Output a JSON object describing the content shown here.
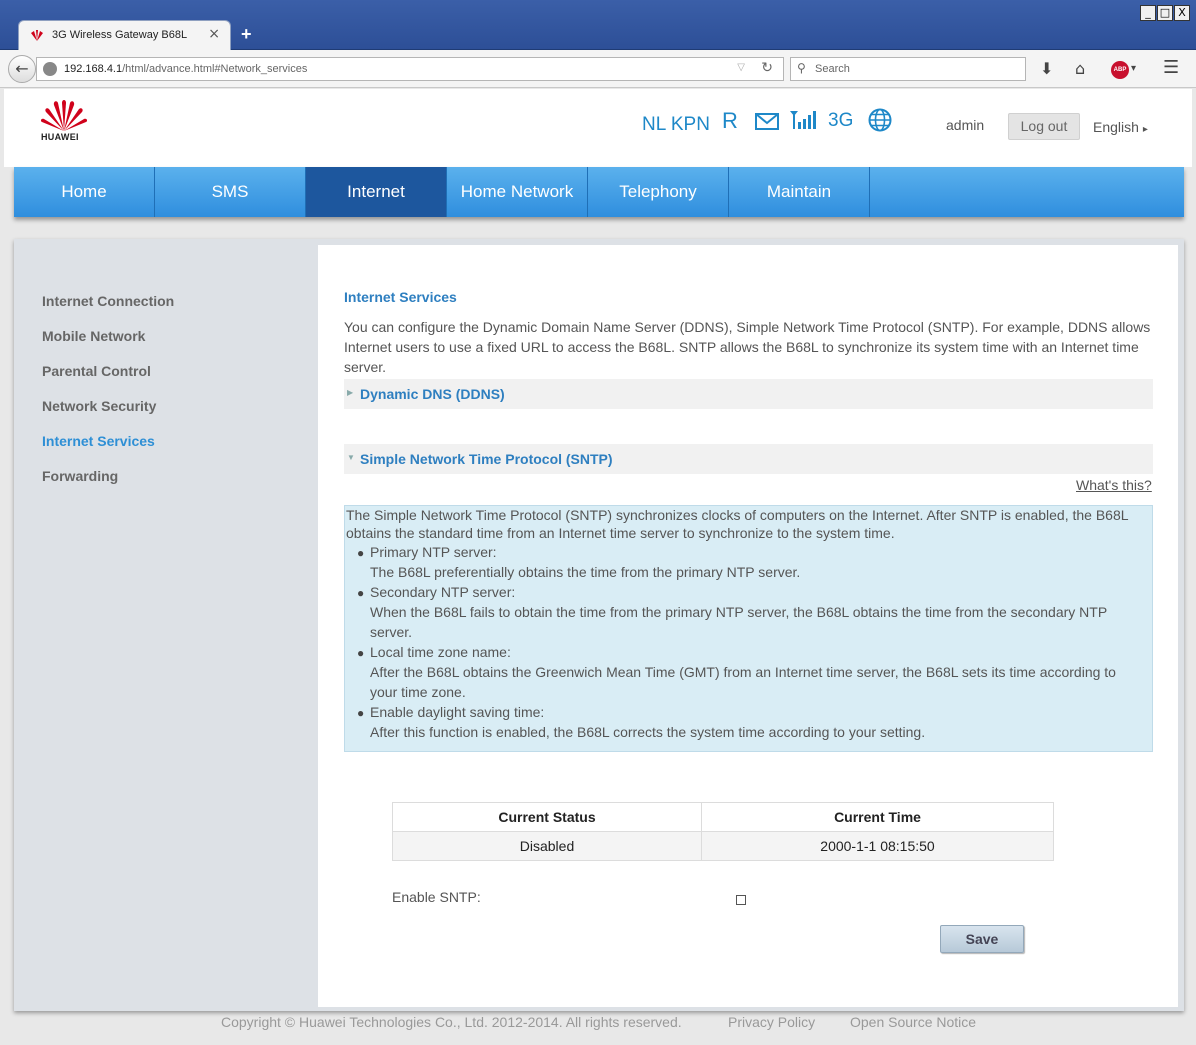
{
  "browser": {
    "tab_title": "3G Wireless Gateway B68L",
    "url_host": "192.168.4.1",
    "url_path": "/html/advance.html#Network_services",
    "search_placeholder": "Search",
    "window_controls": [
      "_",
      "□",
      "X"
    ]
  },
  "header": {
    "logo_text": "HUAWEI",
    "operator": "NL KPN",
    "roaming": "R",
    "network_type": "3G",
    "user": "admin",
    "logout_label": "Log out",
    "language": "English"
  },
  "nav": [
    {
      "label": "Home"
    },
    {
      "label": "SMS"
    },
    {
      "label": "Internet"
    },
    {
      "label": "Home Network"
    },
    {
      "label": "Telephony"
    },
    {
      "label": "Maintain"
    }
  ],
  "sidebar": [
    {
      "label": "Internet Connection"
    },
    {
      "label": "Mobile Network"
    },
    {
      "label": "Parental Control"
    },
    {
      "label": "Network Security"
    },
    {
      "label": "Internet Services"
    },
    {
      "label": "Forwarding"
    }
  ],
  "main": {
    "title": "Internet Services",
    "intro": "You can configure the Dynamic Domain Name Server (DDNS), Simple Network Time Protocol (SNTP). For example, DDNS allows Internet users to use a fixed URL to access the B68L. SNTP allows the B68L to synchronize its system time with an Internet time server.",
    "ddns_label": "Dynamic DNS (DDNS)",
    "sntp_label": "Simple Network Time Protocol (SNTP)",
    "whats_this": "What's this?",
    "help": {
      "summary": "The Simple Network Time Protocol (SNTP) synchronizes clocks of computers on the Internet. After SNTP is enabled, the B68L obtains the standard time from an Internet time server to synchronize to the system time.",
      "items": [
        {
          "title": "Primary NTP server:",
          "desc": "The B68L preferentially obtains the time from the primary NTP server."
        },
        {
          "title": "Secondary NTP server:",
          "desc": "When the B68L fails to obtain the time from the primary NTP server, the B68L obtains the time from the secondary NTP server."
        },
        {
          "title": "Local time zone name:",
          "desc": "After the B68L obtains the Greenwich Mean Time (GMT) from an Internet time server, the B68L sets its time according to your time zone."
        },
        {
          "title": "Enable daylight saving time:",
          "desc": "After this function is enabled, the B68L corrects the system time according to your setting."
        }
      ]
    },
    "table": {
      "headers": [
        "Current Status",
        "Current Time"
      ],
      "row": [
        "Disabled",
        "2000-1-1 08:15:50"
      ]
    },
    "enable_label": "Enable SNTP:",
    "save_label": "Save"
  },
  "footer": {
    "copyright": "Copyright © Huawei Technologies Co., Ltd. 2012-2014. All rights reserved.",
    "privacy": "Privacy Policy",
    "open_source": "Open Source Notice"
  },
  "colors": {
    "accent": "#2e7fc0",
    "nav_active": "#1d579e",
    "help_bg": "#d9edf5"
  }
}
